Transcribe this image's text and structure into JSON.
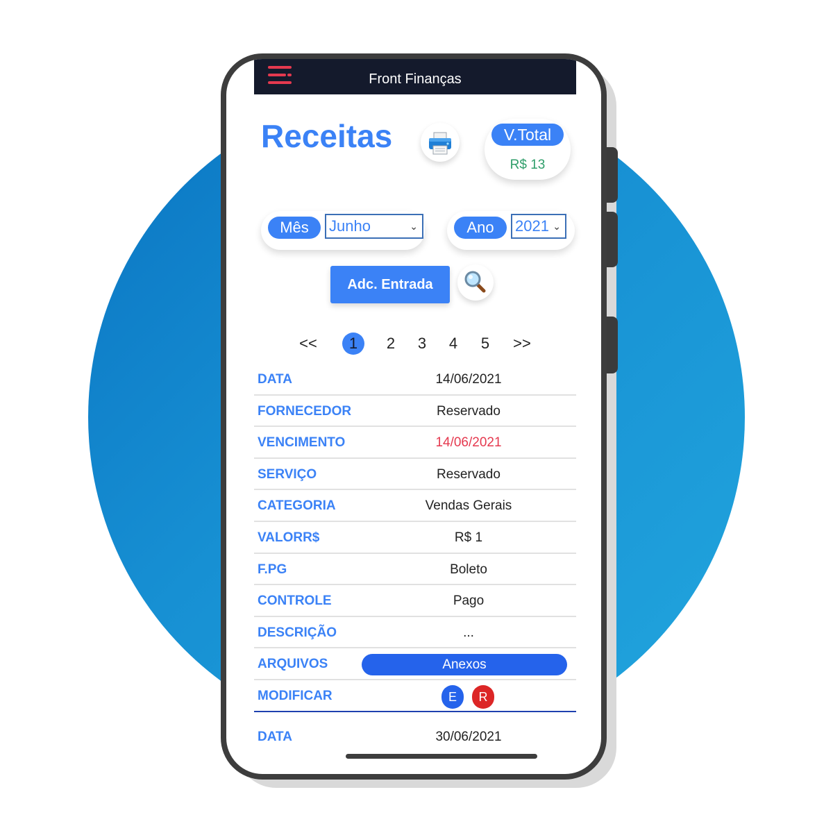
{
  "app": {
    "title": "Front Finanças",
    "page_title": "Receitas"
  },
  "summary": {
    "total_label": "V.Total",
    "total_value": "R$ 13"
  },
  "filters": {
    "month_label": "Mês",
    "month_value": "Junho",
    "year_label": "Ano",
    "year_value": "2021"
  },
  "actions": {
    "add_entry_label": "Adc. Entrada"
  },
  "pagination": {
    "prev": "<<",
    "pages": [
      "1",
      "2",
      "3",
      "4",
      "5"
    ],
    "next": ">>",
    "current": "1"
  },
  "record": {
    "rows": [
      {
        "label": "DATA",
        "value": "14/06/2021"
      },
      {
        "label": "FORNECEDOR",
        "value": "Reservado"
      },
      {
        "label": "VENCIMENTO",
        "value": "14/06/2021"
      },
      {
        "label": "SERVIÇO",
        "value": "Reservado"
      },
      {
        "label": "CATEGORIA",
        "value": "Vendas Gerais"
      },
      {
        "label": "VALORR$",
        "value": "R$ 1"
      },
      {
        "label": "F.PG",
        "value": "Boleto"
      },
      {
        "label": "CONTROLE",
        "value": "Pago"
      },
      {
        "label": "DESCRIÇÃO",
        "value": "..."
      }
    ],
    "files_label": "ARQUIVOS",
    "files_button": "Anexos",
    "modify_label": "MODIFICAR",
    "edit_button": "E",
    "remove_button": "R"
  },
  "next_record": {
    "label": "DATA",
    "value": "30/06/2021"
  },
  "colors": {
    "brand": "#3b82f6",
    "topbar": "#141a2c",
    "menu_icon": "#e5394f",
    "due_date": "#e5394f",
    "total_value": "#2f9e6a",
    "edit": "#2563eb",
    "remove": "#dc2626"
  }
}
